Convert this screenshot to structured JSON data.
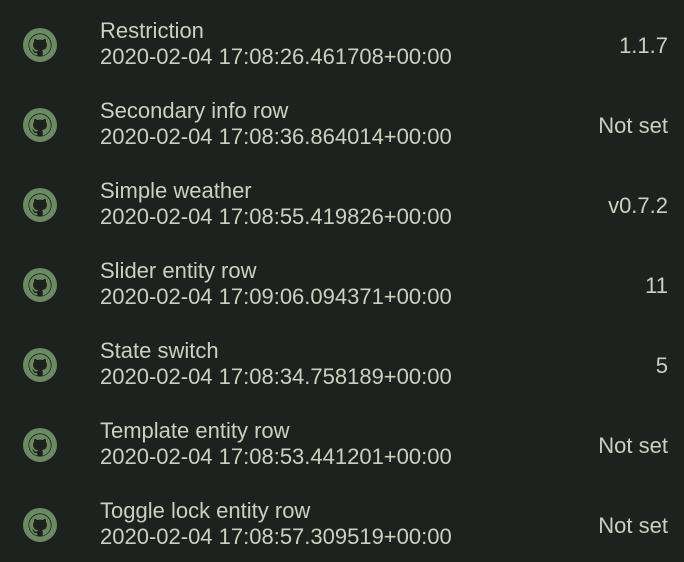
{
  "colors": {
    "background": "#1e221e",
    "text": "#c9d2bf",
    "icon": "#6b8a63"
  },
  "rows": [
    {
      "icon": "github-icon",
      "title": "Restriction",
      "timestamp": "2020-02-04 17:08:26.461708+00:00",
      "version": "1.1.7"
    },
    {
      "icon": "github-icon",
      "title": "Secondary info row",
      "timestamp": "2020-02-04 17:08:36.864014+00:00",
      "version": "Not set"
    },
    {
      "icon": "github-icon",
      "title": "Simple weather",
      "timestamp": "2020-02-04 17:08:55.419826+00:00",
      "version": "v0.7.2"
    },
    {
      "icon": "github-icon",
      "title": "Slider entity row",
      "timestamp": "2020-02-04 17:09:06.094371+00:00",
      "version": "11"
    },
    {
      "icon": "github-icon",
      "title": "State switch",
      "timestamp": "2020-02-04 17:08:34.758189+00:00",
      "version": "5"
    },
    {
      "icon": "github-icon",
      "title": "Template entity row",
      "timestamp": "2020-02-04 17:08:53.441201+00:00",
      "version": "Not set"
    },
    {
      "icon": "github-icon",
      "title": "Toggle lock entity row",
      "timestamp": "2020-02-04 17:08:57.309519+00:00",
      "version": "Not set"
    }
  ]
}
